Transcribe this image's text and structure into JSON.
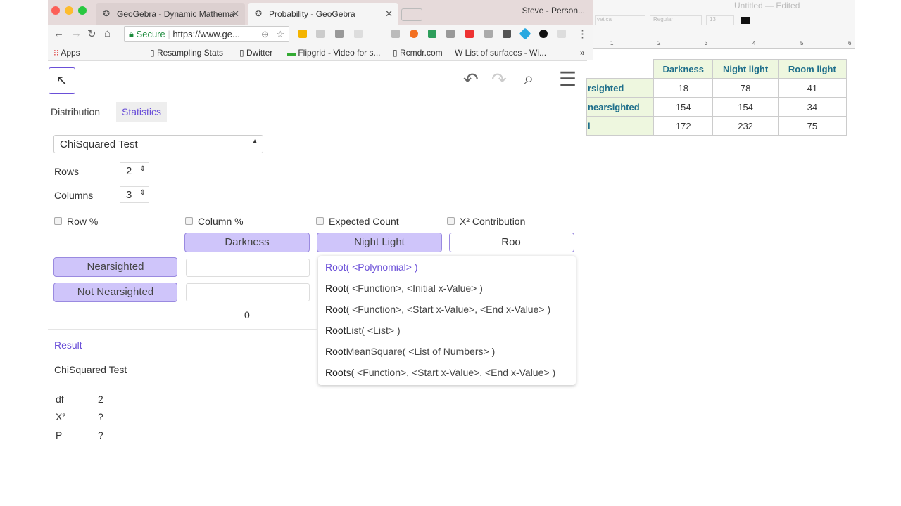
{
  "browser": {
    "tabs": [
      {
        "label": "GeoGebra - Dynamic Mathema",
        "active": false
      },
      {
        "label": "Probability - GeoGebra",
        "active": true
      }
    ],
    "profile": "Steve - Person...",
    "secure_label": "Secure",
    "url": "https://www.ge...",
    "bookmarks": [
      "Apps",
      "Resampling Stats",
      "Dwitter",
      "Flipgrid - Video for s...",
      "Rcmdr.com",
      "List of surfaces - Wi..."
    ],
    "more": "»"
  },
  "app": {
    "tabs": [
      "Distribution",
      "Statistics"
    ],
    "active_tab": "Statistics",
    "test_select": "ChiSquared Test",
    "rows_label": "Rows",
    "rows_value": "2",
    "columns_label": "Columns",
    "columns_value": "3",
    "options": [
      "Row %",
      "Column %",
      "Expected Count",
      "X² Contribution"
    ],
    "col_headers": [
      "Darkness",
      "Night Light"
    ],
    "editing_header": "Roo",
    "row_headers": [
      "Nearsighted",
      "Not Nearsighted"
    ],
    "col_total": "0",
    "suggestions": [
      {
        "match": "Root",
        "rest": "( <Polynomial> )",
        "highlight": true
      },
      {
        "match": "Root",
        "rest": "( <Function>, <Initial x-Value> )"
      },
      {
        "match": "Root",
        "rest": "( <Function>, <Start x-Value>, <End x-Value> )"
      },
      {
        "match": "Root",
        "rest": "List( <List> )"
      },
      {
        "match": "Root",
        "rest": "MeanSquare( <List of Numbers> )"
      },
      {
        "match": "Root",
        "rest": "s( <Function>, <Start x-Value>, <End x-Value> )"
      }
    ],
    "result_label": "Result",
    "result_title": "ChiSquared Test",
    "results": [
      {
        "k": "df",
        "v": "2"
      },
      {
        "k": "X²",
        "v": "?"
      },
      {
        "k": "P",
        "v": "?"
      }
    ],
    "accent": "#6a4fd8"
  },
  "textedit": {
    "title": "Untitled — Edited",
    "font": "vetica",
    "style": "Regular",
    "size": "13",
    "ruler": [
      "1",
      "2",
      "3",
      "4",
      "5",
      "6"
    ],
    "table": {
      "headers": [
        "Darkness",
        "Night light",
        "Room light"
      ],
      "rows": [
        {
          "label": "rsighted",
          "values": [
            "18",
            "78",
            "41"
          ]
        },
        {
          "label": "nearsighted",
          "values": [
            "154",
            "154",
            "34"
          ]
        },
        {
          "label": "l",
          "values": [
            "172",
            "232",
            "75"
          ]
        }
      ]
    }
  }
}
